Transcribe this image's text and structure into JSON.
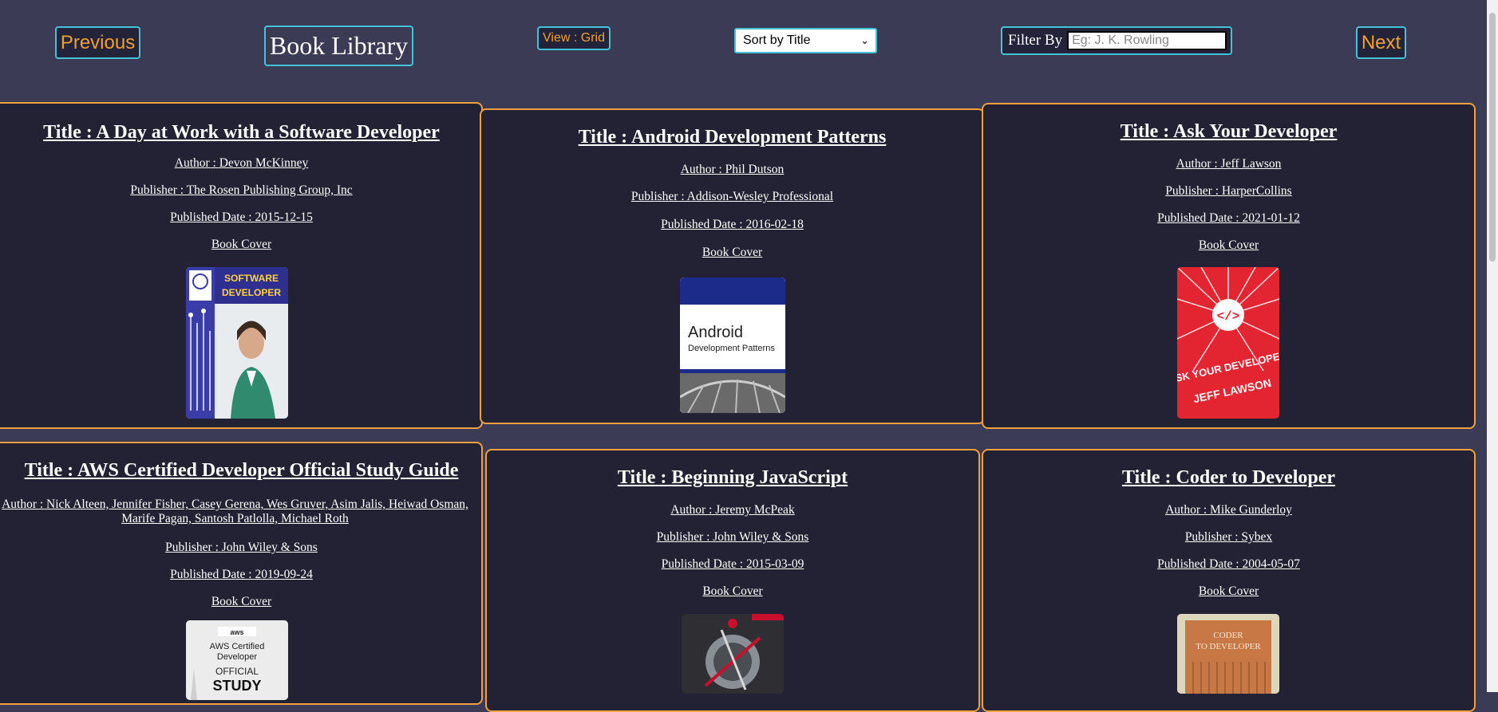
{
  "header": {
    "previous_label": "Previous",
    "app_title": "Book Library",
    "view_label": "View : Grid",
    "sort_selected": "Sort by Title",
    "filter_label": "Filter By",
    "filter_placeholder": "Eg: J. K. Rowling",
    "next_label": "Next"
  },
  "books": [
    {
      "title": "Title : A Day at Work with a Software Developer",
      "author": "Author : Devon McKinney",
      "publisher": "Publisher : The Rosen Publishing Group, Inc",
      "date": "Published Date : 2015-12-15",
      "cover_label": "Book Cover"
    },
    {
      "title": "Title : Android Development Patterns",
      "author": "Author : Phil Dutson",
      "publisher": "Publisher : Addison-Wesley Professional",
      "date": "Published Date : 2016-02-18",
      "cover_label": "Book Cover"
    },
    {
      "title": "Title : Ask Your Developer",
      "author": "Author : Jeff Lawson",
      "publisher": "Publisher : HarperCollins",
      "date": "Published Date : 2021-01-12",
      "cover_label": "Book Cover"
    },
    {
      "title": "Title : AWS Certified Developer Official Study Guide",
      "author": "Author : Nick Alteen, Jennifer Fisher, Casey Gerena, Wes Gruver, Asim Jalis, Heiwad Osman, Marife Pagan, Santosh Patlolla, Michael Roth",
      "publisher": "Publisher : John Wiley & Sons",
      "date": "Published Date : 2019-09-24",
      "cover_label": "Book Cover"
    },
    {
      "title": "Title : Beginning JavaScript",
      "author": "Author : Jeremy McPeak",
      "publisher": "Publisher : John Wiley & Sons",
      "date": "Published Date : 2015-03-09",
      "cover_label": "Book Cover"
    },
    {
      "title": "Title : Coder to Developer",
      "author": "Author : Mike Gunderloy",
      "publisher": "Publisher : Sybex",
      "date": "Published Date : 2004-05-07",
      "cover_label": "Book Cover"
    }
  ],
  "covers": {
    "c1_text": "A Day at Work with a SOFTWARE DEVELOPER",
    "c2_text": "Android Development Patterns",
    "c3_text": "ASK YOUR DEVELOPER",
    "c3_author": "JEFF LAWSON",
    "c4_text": "AWS Certified Developer OFFICIAL STUDY GUIDE",
    "c6_text": "CODER TO DEVELOPER"
  }
}
